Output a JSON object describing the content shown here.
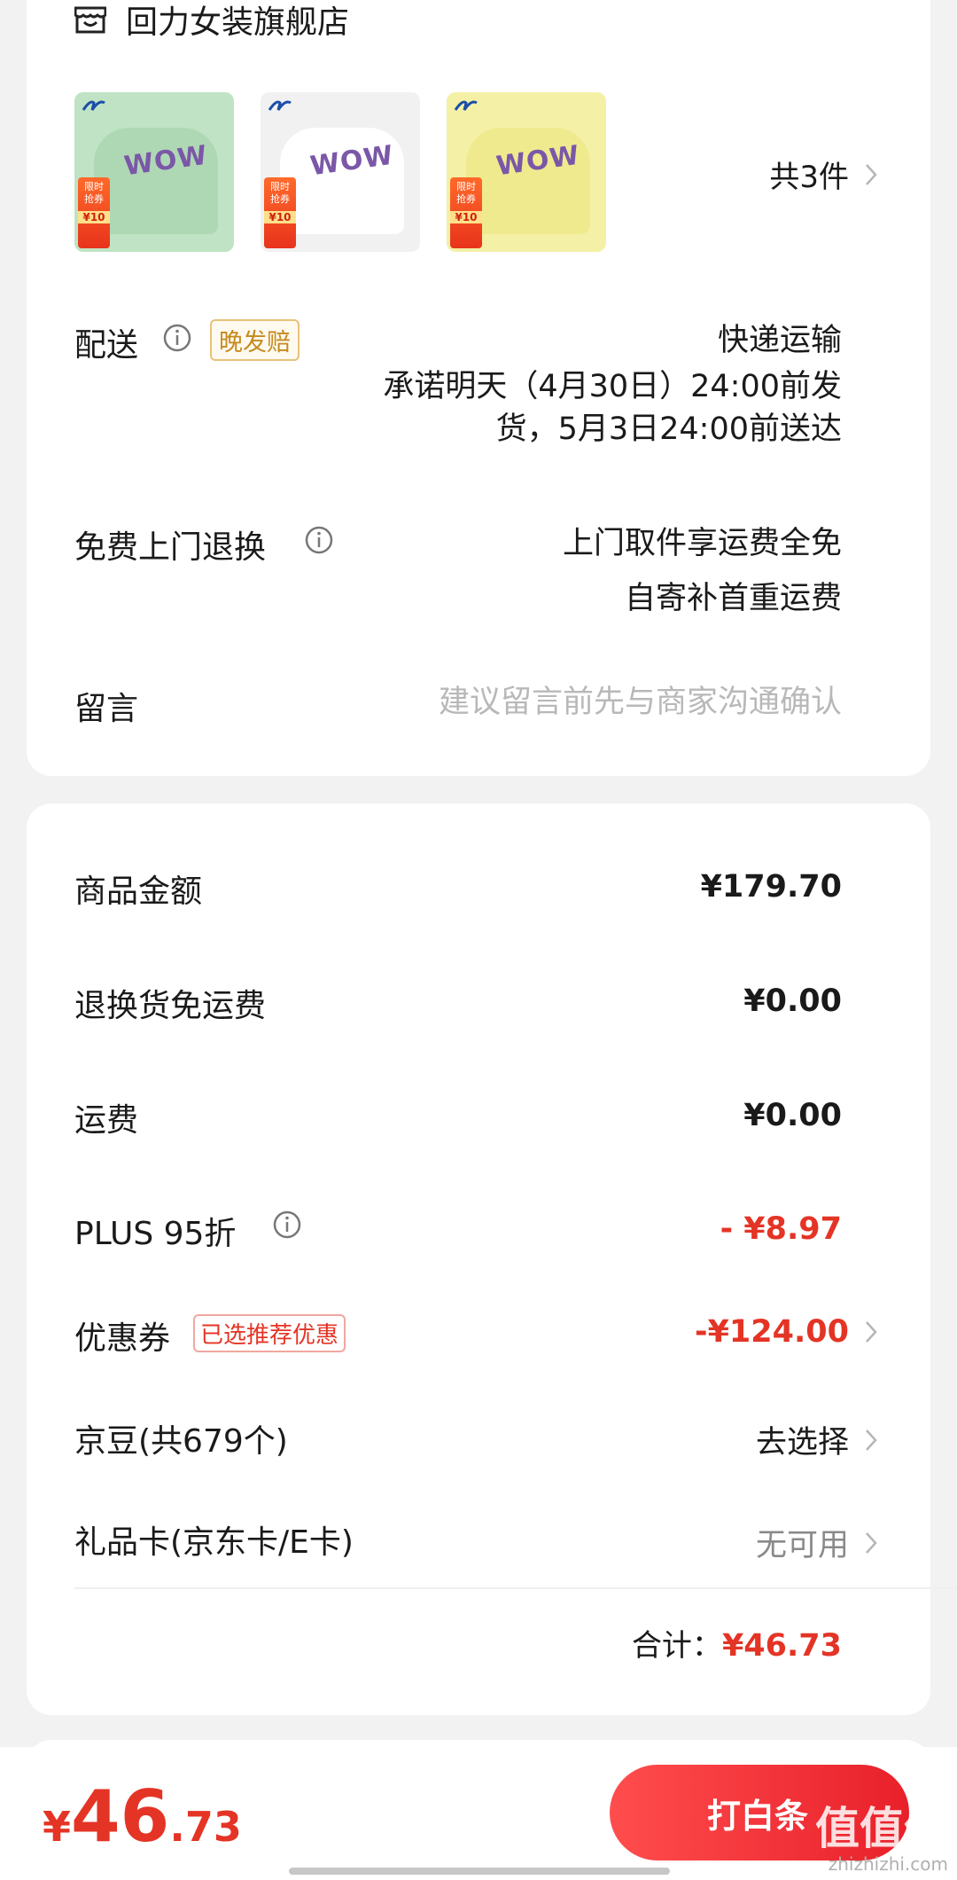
{
  "store": {
    "name": "回力女装旗舰店"
  },
  "products": {
    "thumbs": [
      {
        "color": "#bfe3c4",
        "brand": "回力",
        "print": "WOW",
        "tag_a": "限时",
        "tag_b": "抢券",
        "tag_c": "¥10"
      },
      {
        "color": "#f1f1f1",
        "brand": "回力",
        "print": "WOW",
        "tag_a": "限时",
        "tag_b": "抢券",
        "tag_c": "¥10"
      },
      {
        "color": "#f4f0a6",
        "brand": "回力",
        "print": "WOW",
        "tag_a": "限时",
        "tag_b": "抢券",
        "tag_c": "¥10"
      }
    ],
    "count_label": "共3件"
  },
  "delivery": {
    "label": "配送",
    "badge": "晚发赔",
    "method": "快递运输",
    "promise_line1": "承诺明天（4月30日）24:00前发",
    "promise_line2": "货，5月3日24:00前送达"
  },
  "returns": {
    "label": "免费上门退换",
    "line1": "上门取件享运费全免",
    "line2": "自寄补首重运费"
  },
  "message": {
    "label": "留言",
    "placeholder": "建议留言前先与商家沟通确认"
  },
  "price_rows": {
    "goods_label": "商品金额",
    "goods_value": "¥179.70",
    "return_ship_label": "退换货免运费",
    "return_ship_value": "¥0.00",
    "shipping_label": "运费",
    "shipping_value": "¥0.00",
    "plus_label": "PLUS 95折",
    "plus_value": "- ¥8.97",
    "coupon_label": "优惠券",
    "coupon_badge": "已选推荐优惠",
    "coupon_value": "-¥124.00",
    "beans_label": "京豆(共679个)",
    "beans_value": "去选择",
    "giftcard_label": "礼品卡(京东卡/E卡)",
    "giftcard_value": "无可用",
    "total_label": "合计：",
    "total_value": "¥46.73"
  },
  "bottom": {
    "currency": "¥",
    "price_int": "46",
    "price_dec": ".73",
    "pay_label": "打白条",
    "watermark": "值值值",
    "watermark_sub": "zhizhizhi.com"
  },
  "colors": {
    "accent": "#e43425",
    "badge_gold": "#c58a1c"
  },
  "icons": {
    "store": "store-icon",
    "chevron": "chevron-right-icon",
    "info": "info-icon"
  }
}
